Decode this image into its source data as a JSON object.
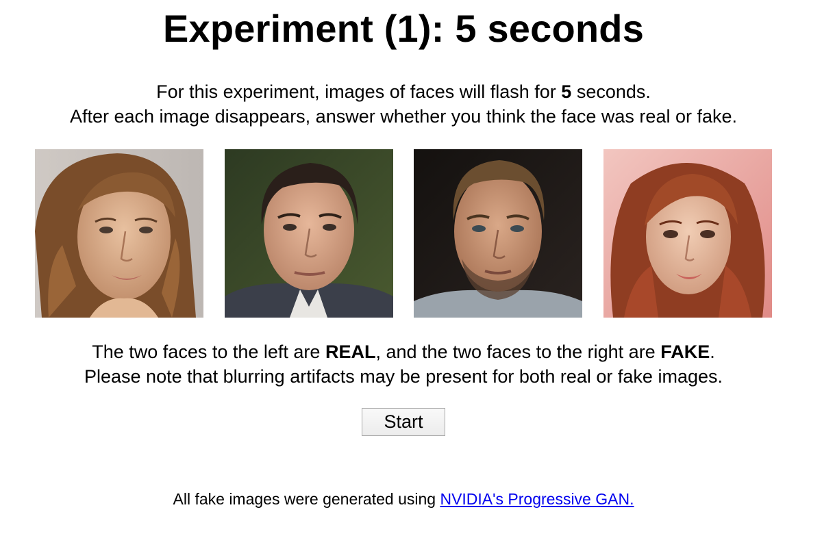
{
  "header": {
    "title": "Experiment (1): 5 seconds"
  },
  "intro": {
    "line1_pre": "For this experiment, images of faces will flash for ",
    "line1_bold": "5",
    "line1_post": " seconds.",
    "line2": "After each image disappears, answer whether you think the face was real or fake."
  },
  "faces": [
    {
      "label": "real",
      "kind": "real-face-woman-photo"
    },
    {
      "label": "real",
      "kind": "real-face-man-photo"
    },
    {
      "label": "fake",
      "kind": "fake-face-man-photo"
    },
    {
      "label": "fake",
      "kind": "fake-face-woman-photo"
    }
  ],
  "explanation": {
    "line1_pre": "The two faces to the left are ",
    "line1_real": "REAL",
    "line1_mid": ", and the two faces to the right are ",
    "line1_fake": "FAKE",
    "line1_post": ".",
    "line2": "Please note that blurring artifacts may be present for both real or fake images."
  },
  "start_button": {
    "label": "Start"
  },
  "footer": {
    "text": "All fake images were generated using ",
    "link_text": "NVIDIA's Progressive GAN."
  },
  "colors": {
    "link": "#0000ee",
    "button_border": "#a9a9a9"
  }
}
